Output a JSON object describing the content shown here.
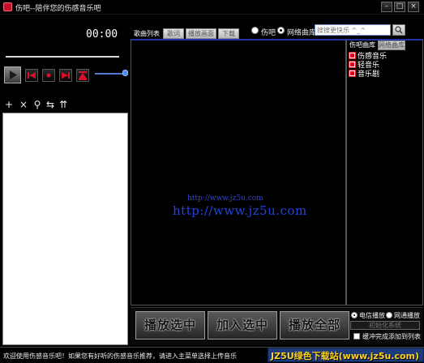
{
  "window": {
    "title": "伤吧--陪伴您的伤感音乐吧",
    "minimize_label": "–",
    "maximize_label": "□",
    "close_label": "×"
  },
  "player": {
    "time": "00:00",
    "progress": 0,
    "volume": 1.0
  },
  "toolbar": {
    "icons": [
      "add-icon",
      "delete-icon",
      "search-icon",
      "sort-icon",
      "clear-icon"
    ],
    "glyphs": [
      "+",
      "×",
      "⚲",
      "⇆",
      "⇈"
    ]
  },
  "tabs": [
    {
      "label": "歌曲列表",
      "active": true
    },
    {
      "label": "歌词",
      "active": false
    },
    {
      "label": "播放画面",
      "active": false
    },
    {
      "label": "下载",
      "active": false
    }
  ],
  "source": {
    "options": [
      {
        "label": "伤吧",
        "selected": false
      },
      {
        "label": "网络曲库",
        "selected": true
      }
    ]
  },
  "search": {
    "placeholder": "搜搜更快乐 ^_^"
  },
  "watermark": {
    "small": "http://www.jz5u.com",
    "big": "http://www.jz5u.com"
  },
  "right_panel": {
    "tabs": [
      {
        "label": "伤吧曲库",
        "active": true
      },
      {
        "label": "网络曲库",
        "active": false
      }
    ],
    "categories": [
      {
        "label": "伤感音乐",
        "checked": true
      },
      {
        "label": "轻音乐",
        "checked": true
      },
      {
        "label": "音乐剧",
        "checked": true
      }
    ]
  },
  "actions": {
    "play_selected": "播放选中",
    "add_selected": "加入选中",
    "play_all": "播放全部"
  },
  "playback_mode": {
    "options": [
      {
        "label": "电信播放",
        "selected": true
      },
      {
        "label": "网通播放",
        "selected": false
      }
    ],
    "init_label": "初始化系统",
    "loop_label": "缓冲完成添加到列表",
    "loop_checked": false
  },
  "status": {
    "text": "欢迎使用伤感音乐吧！如果您有好听的伤感音乐推荐，请进入主菜单选择上传音乐"
  },
  "badge": {
    "text": "JZ5U绿色下载站(www.jz5u.com)"
  },
  "colors": {
    "accent_blue": "#2244dd",
    "badge_bg": "#1d3a7a",
    "badge_text": "#ffd21e",
    "record_red": "#d8102a"
  }
}
